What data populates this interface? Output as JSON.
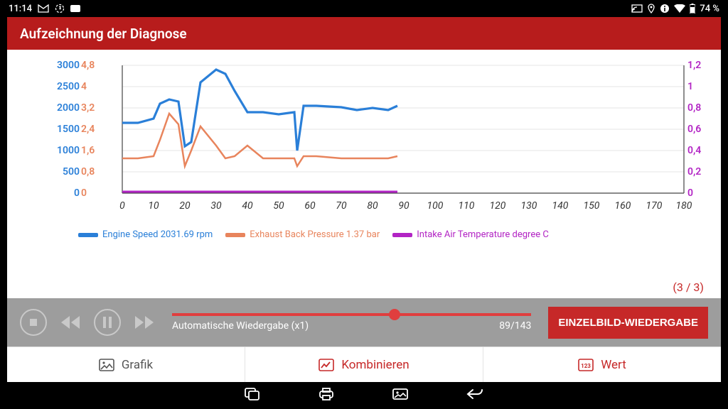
{
  "status": {
    "time": "11:14",
    "battery": "74 %"
  },
  "header": {
    "title": "Aufzeichnung der Diagnose"
  },
  "chart_data": {
    "type": "line",
    "x_range": [
      0,
      180
    ],
    "x_ticks": [
      0,
      10,
      20,
      30,
      40,
      50,
      60,
      70,
      80,
      90,
      100,
      110,
      120,
      130,
      140,
      150,
      160,
      170,
      180
    ],
    "y_axes": [
      {
        "label": "Engine Speed",
        "unit": "rpm",
        "range": [
          0,
          3000
        ],
        "ticks": [
          0,
          500,
          1000,
          1500,
          2000,
          2500,
          3000
        ],
        "color": "#2a7fd8"
      },
      {
        "label": "Exhaust Back Pressure",
        "unit": "bar",
        "range": [
          0,
          4.8
        ],
        "ticks": [
          0,
          0.8,
          1.6,
          2.4,
          3.2,
          4,
          4.8
        ],
        "color": "#e8845c"
      },
      {
        "label": "Intake Air Temperature",
        "unit": "degree C",
        "range": [
          0,
          1.2
        ],
        "ticks": [
          0,
          0.2,
          0.4,
          0.6,
          0.8,
          1,
          1.2
        ],
        "color": "#b224c4"
      }
    ],
    "series": [
      {
        "name": "Engine Speed",
        "current_value": "2031.69 rpm",
        "color": "#2a7fd8",
        "x": [
          0,
          5,
          10,
          12,
          15,
          18,
          20,
          22,
          25,
          30,
          33,
          36,
          40,
          45,
          50,
          55,
          56,
          58,
          62,
          70,
          75,
          80,
          85,
          88
        ],
        "y": [
          1650,
          1650,
          1750,
          2100,
          2200,
          2150,
          1100,
          1200,
          2600,
          2900,
          2800,
          2400,
          1900,
          1900,
          1850,
          1900,
          1000,
          2050,
          2050,
          2020,
          1950,
          2000,
          1950,
          2050
        ]
      },
      {
        "name": "Exhaust Back Pressure",
        "current_value": "1.37 bar",
        "color": "#e8845c",
        "x": [
          0,
          5,
          10,
          12,
          15,
          18,
          20,
          22,
          25,
          30,
          33,
          36,
          40,
          45,
          50,
          55,
          56,
          58,
          62,
          70,
          75,
          80,
          85,
          88
        ],
        "y": [
          1.3,
          1.3,
          1.4,
          2.0,
          3.0,
          2.6,
          1.0,
          1.6,
          2.5,
          1.8,
          1.3,
          1.4,
          1.8,
          1.3,
          1.3,
          1.3,
          1.0,
          1.4,
          1.4,
          1.3,
          1.3,
          1.3,
          1.3,
          1.4
        ]
      },
      {
        "name": "Intake Air Temperature",
        "current_value": "",
        "color": "#b224c4",
        "x": [
          0,
          88
        ],
        "y": [
          0.02,
          0.02
        ]
      }
    ]
  },
  "legend": {
    "item1": "Engine Speed 2031.69 rpm",
    "item2": "Exhaust Back Pressure 1.37 bar",
    "item3": "Intake Air Temperature  degree C"
  },
  "page_counter": "(3 / 3)",
  "playback": {
    "mode_label": "Automatische Wiedergabe (x1)",
    "frame_position": "89/143",
    "seek_percent": 62,
    "single_frame_button": "EINZELBILD-WIEDERGABE"
  },
  "tabs": {
    "graphic": "Grafik",
    "combine": "Kombinieren",
    "value": "Wert"
  }
}
